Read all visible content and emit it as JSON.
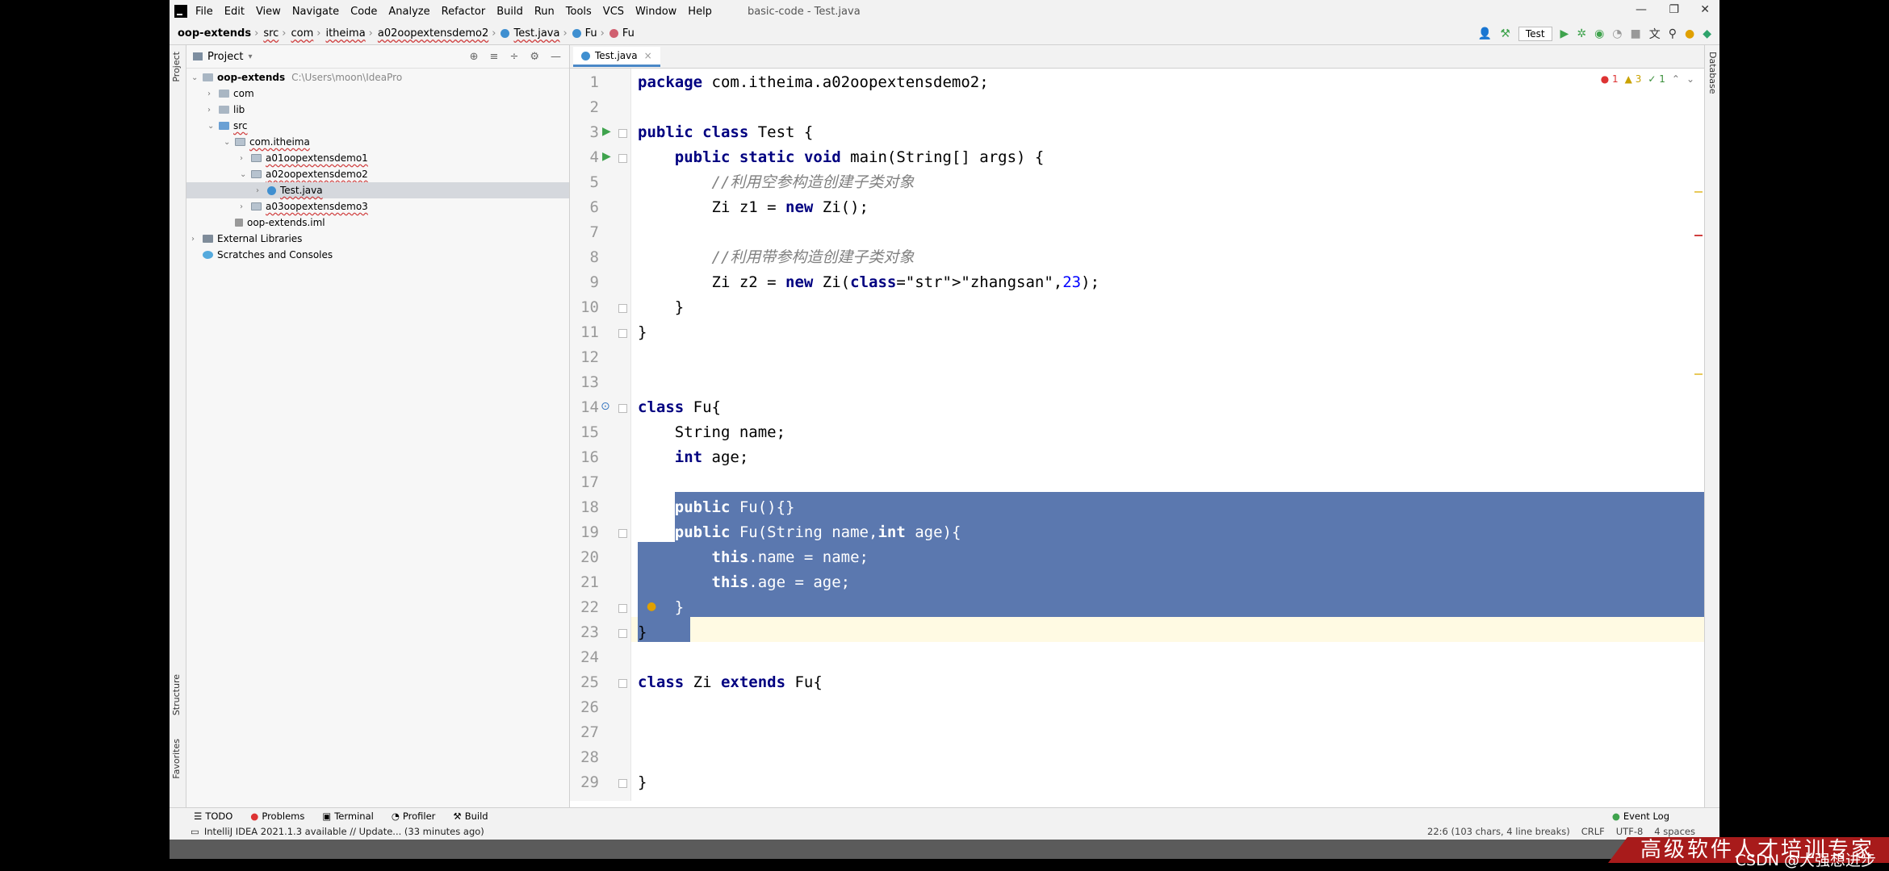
{
  "window": {
    "menu": [
      "File",
      "Edit",
      "View",
      "Navigate",
      "Code",
      "Analyze",
      "Refactor",
      "Build",
      "Run",
      "Tools",
      "VCS",
      "Window",
      "Help"
    ],
    "title": "basic-code - Test.java"
  },
  "breadcrumbs": [
    "oop-extends",
    "src",
    "com",
    "itheima",
    "a02oopextensdemo2",
    "Test.java",
    "Fu",
    "Fu"
  ],
  "run_config": "Test",
  "project_panel": {
    "title": "Project",
    "tree": [
      {
        "label": "oop-extends",
        "path": "C:\\Users\\moon\\IdeaPro",
        "indent": 0,
        "arrow": "v",
        "icon": "folder"
      },
      {
        "label": "com",
        "indent": 1,
        "arrow": ">",
        "icon": "folder"
      },
      {
        "label": "lib",
        "indent": 1,
        "arrow": ">",
        "icon": "folder"
      },
      {
        "label": "src",
        "indent": 1,
        "arrow": "v",
        "icon": "src"
      },
      {
        "label": "com.itheima",
        "indent": 2,
        "arrow": "v",
        "icon": "pkg"
      },
      {
        "label": "a01oopextensdemo1",
        "indent": 3,
        "arrow": ">",
        "icon": "pkg"
      },
      {
        "label": "a02oopextensdemo2",
        "indent": 3,
        "arrow": "v",
        "icon": "pkg"
      },
      {
        "label": "Test.java",
        "indent": 4,
        "arrow": ">",
        "icon": "java",
        "selected": true
      },
      {
        "label": "a03oopextensdemo3",
        "indent": 3,
        "arrow": ">",
        "icon": "pkg"
      },
      {
        "label": "oop-extends.iml",
        "indent": 2,
        "arrow": "",
        "icon": "iml"
      },
      {
        "label": "External Libraries",
        "indent": 0,
        "arrow": ">",
        "icon": "lib"
      },
      {
        "label": "Scratches and Consoles",
        "indent": 0,
        "arrow": "",
        "icon": "scratch"
      }
    ]
  },
  "side_tabs": {
    "left_top": "Project",
    "left_mid": "Structure",
    "left_bottom": "Favorites",
    "right": "Database"
  },
  "editor": {
    "tab": "Test.java",
    "inspections": {
      "errors": "1",
      "warnings": "3",
      "ok": "1"
    },
    "lines": [
      "package com.itheima.a02oopextensdemo2;",
      "",
      "public class Test {",
      "    public static void main(String[] args) {",
      "        //利用空参构造创建子类对象",
      "        Zi z1 = new Zi();",
      "",
      "        //利用带参构造创建子类对象",
      "        Zi z2 = new Zi(\"zhangsan\",23);",
      "    }",
      "}",
      "",
      "",
      "class Fu{",
      "    String name;",
      "    int age;",
      "",
      "    public Fu(){}",
      "    public Fu(String name,int age){",
      "        this.name = name;",
      "        this.age = age;",
      "    }",
      "}",
      "",
      "class Zi extends Fu{",
      "",
      "",
      "",
      "}"
    ]
  },
  "bottom_tools": [
    "TODO",
    "Problems",
    "Terminal",
    "Profiler",
    "Build"
  ],
  "event_log": "Event Log",
  "status": {
    "message": "IntelliJ IDEA 2021.1.3 available // Update... (33 minutes ago)",
    "position": "22:6 (103 chars, 4 line breaks)",
    "line_sep": "CRLF",
    "encoding": "UTF-8",
    "indent": "4 spaces"
  },
  "overlay": {
    "banner": "高级软件人才培训专家",
    "watermark": "CSDN @大强想进步"
  }
}
